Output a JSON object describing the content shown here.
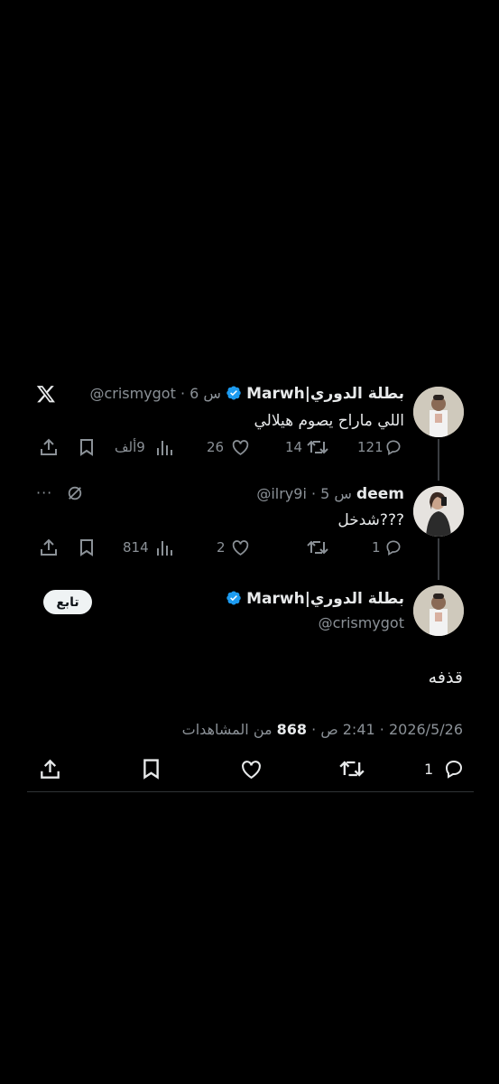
{
  "app": {
    "logo": "X"
  },
  "tweet1": {
    "display_name": "بطلة الدوري|Marwh",
    "handle_time": "@crismygot · 6 س",
    "text": "اللي ماراح يصوم هيلالي",
    "reply_count": "121",
    "retweet_count": "14",
    "like_count": "26",
    "views_count": "9ألف"
  },
  "reply1": {
    "display_name": "deem",
    "handle_time": "@ilry9i · 5 س",
    "text": "???شدخل",
    "reply_count": "1",
    "retweet_count": "",
    "like_count": "2",
    "views_count": "814",
    "more": "···"
  },
  "main_tweet": {
    "display_name": "بطلة الدوري|Marwh",
    "handle": "@crismygot",
    "follow_label": "تابع",
    "text": "قذفه",
    "meta_date_time": "2026/5/26 · 2:41 ص · ",
    "views_number": "868",
    "views_label": " من المشاهدات",
    "reply_count": "1"
  },
  "colors": {
    "verified": "#1d9bf0",
    "muted": "#8b9197",
    "text": "#e7e9ea",
    "background": "#000000"
  },
  "icons": [
    "x-logo-icon",
    "verified-badge-icon",
    "reply-icon",
    "retweet-icon",
    "like-icon",
    "views-icon",
    "bookmark-icon",
    "share-icon",
    "more-icon",
    "grok-icon"
  ]
}
